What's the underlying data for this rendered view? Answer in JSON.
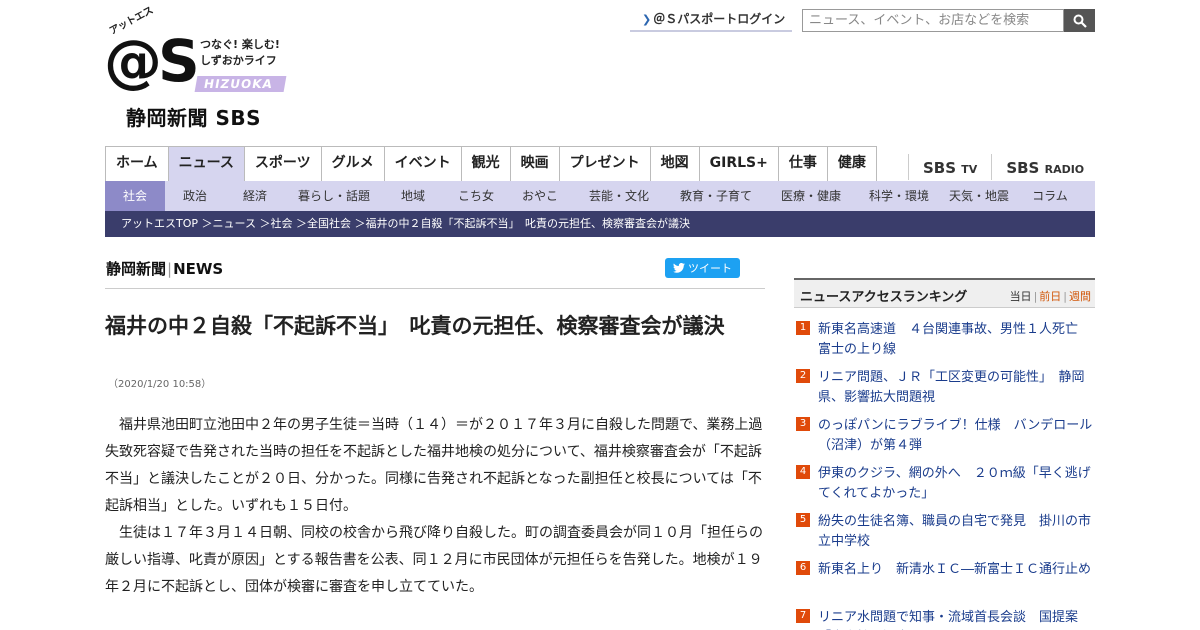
{
  "logo": {
    "kana": "アットエス",
    "mark": "@S",
    "tagline1": "つなぐ! 楽しむ!",
    "tagline2": "しずおかライフ",
    "region": "HIZUOKA",
    "paper": "静岡新聞 SBS"
  },
  "header": {
    "passport_label": "＠Ｓパスポートログイン",
    "search_placeholder": "ニュース、イベント、お店などを検索"
  },
  "main_nav": [
    "ホーム",
    "ニュース",
    "スポーツ",
    "グルメ",
    "イベント",
    "観光",
    "映画",
    "プレゼント",
    "地図",
    "GIRLS+",
    "仕事",
    "健康"
  ],
  "main_nav_active": "ニュース",
  "tv_links": [
    {
      "main": "SBS",
      "sub": "TV"
    },
    {
      "main": "SBS",
      "sub": "RADIO"
    }
  ],
  "sub_nav": [
    "社会",
    "政治",
    "経済",
    "暮らし・話題",
    "地域",
    "こち女",
    "おやこ",
    "芸能・文化",
    "教育・子育て",
    "医療・健康",
    "科学・環境",
    "天気・地震",
    "コラム"
  ],
  "sub_nav_active": "社会",
  "breadcrumb": "アットエスTOP ＞ニュース ＞社会 ＞全国社会 ＞福井の中２自殺「不起訴不当」　叱責の元担任、検察審査会が議決",
  "article": {
    "source_main": "静岡新聞",
    "source_sep": "|",
    "source_sub": "NEWS",
    "tweet_label": "ツイート",
    "headline": "福井の中２自殺「不起訴不当」　叱責の元担任、検察審査会が議決",
    "date": "（2020/1/20 10:58）",
    "paragraphs": [
      "福井県池田町立池田中２年の男子生徒＝当時（１４）＝が２０１７年３月に自殺した問題で、業務上過失致死容疑で告発された当時の担任を不起訴とした福井地検の処分について、福井検察審査会が「不起訴不当」と議決したことが２０日、分かった。同様に告発され不起訴となった副担任と校長については「不起訴相当」とした。いずれも１５日付。",
      "生徒は１７年３月１４日朝、同校の校舎から飛び降り自殺した。町の調査委員会が同１０月「担任らの厳しい指導、叱責が原因」とする報告書を公表、同１２月に市民団体が元担任らを告発した。地検が１９年２月に不起訴とし、団体が検審に審査を申し立てていた。"
    ]
  },
  "ranking": {
    "title": "ニュースアクセスランキング",
    "tabs": [
      "当日",
      "前日",
      "週間"
    ],
    "items": [
      {
        "num": "1",
        "text": "新東名高速道　４台関連事故、男性１人死亡　富士の上り線"
      },
      {
        "num": "2",
        "text": "リニア問題、ＪＲ「工区変更の可能性」　静岡県、影響拡大問題視"
      },
      {
        "num": "3",
        "text": "のっぽパンにラブライブ！仕様　バンデロール（沼津）が第４弾"
      },
      {
        "num": "4",
        "text": "伊東のクジラ、網の外へ　２０ｍ級「早く逃げてくれてよかった」"
      },
      {
        "num": "5",
        "text": "紛失の生徒名簿、職員の自宅で発見　掛川の市立中学校"
      },
      {
        "num": "6",
        "text": "新東名上り　新清水ＩＣ―新富士ＩＣ通行止め"
      },
      {
        "num": "7",
        "text": "リニア水問題で知事・流域首長会談　国提案「中立性に疑念」"
      }
    ]
  }
}
